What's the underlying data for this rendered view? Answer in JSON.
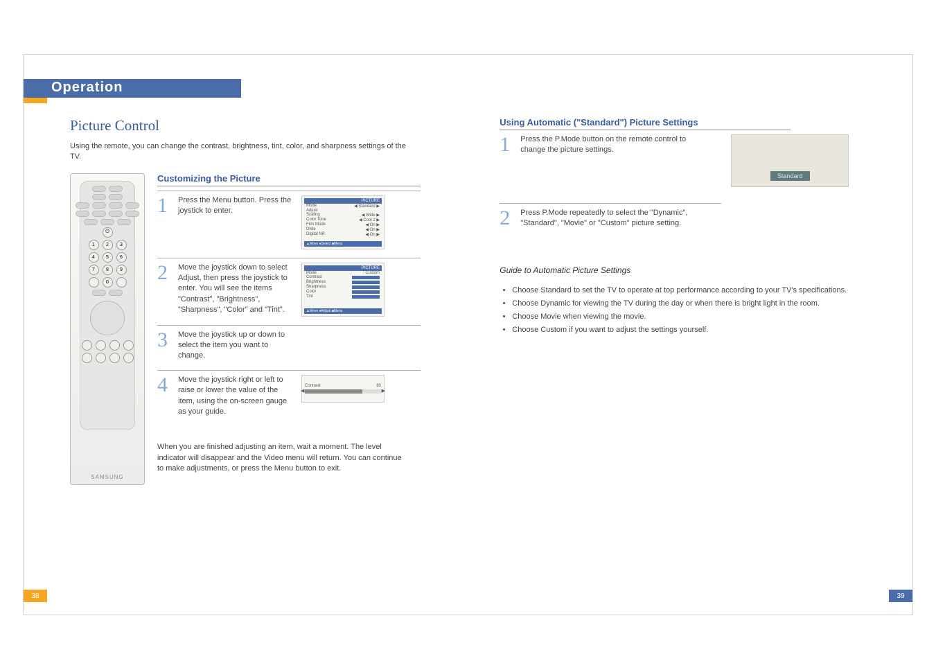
{
  "header": {
    "operation": "Operation"
  },
  "left": {
    "section_title": "Picture Control",
    "intro": "Using the remote, you can change the contrast, brightness, tint, color, and sharpness settings of the TV.",
    "customizing_heading": "Customizing the Picture",
    "remote_brand": "SAMSUNG",
    "steps": {
      "s1_num": "1",
      "s1_text": "Press the Menu button. Press the joystick to enter.",
      "s2_num": "2",
      "s2_text": "Move the joystick down to select Adjust, then press the joystick to enter. You will see the items \"Contrast\", \"Brightness\", \"Sharpness\", \"Color\" and \"Tint\".",
      "s3_num": "3",
      "s3_text": "Move the joystick up or down to select the item you want to change.",
      "s4_num": "4",
      "s4_text": "Move the joystick right or left to raise or lower the value of the item, using the on-screen gauge as your guide."
    },
    "after": "When you are finished adjusting an item, wait a moment. The level indicator will disappear and the Video menu will return. You can continue to make adjustments, or press the Menu button to exit.",
    "osd1": {
      "title": "PICTURE",
      "rows": [
        [
          "Mode",
          "◀ Standard ▶"
        ],
        [
          "Adjust",
          ""
        ],
        [
          "Scaling",
          "◀   Wide   ▶"
        ],
        [
          "Color Tone",
          "◀  Cool 2  ▶"
        ],
        [
          "Film Mode",
          "◀    On    ▶"
        ],
        [
          "DNIe",
          "◀    On    ▶"
        ],
        [
          "Digital NR",
          "◀    On    ▶"
        ]
      ],
      "foot": "▲Move  ●Select  ■Menu"
    },
    "osd2": {
      "title": "PICTURE",
      "mode_row": [
        "Mode",
        ": Custom"
      ],
      "items": [
        "Contrast",
        "Brightness",
        "Sharpness",
        "Color",
        "Tint"
      ],
      "foot": "▲Move  ●Adjust  ■Menu"
    },
    "slider": {
      "label": "Contrast",
      "value": "80"
    }
  },
  "right": {
    "heading": "Using Automatic (\"Standard\") Picture Settings",
    "standard_label": "Standard",
    "s1_num": "1",
    "s1_text": "Press the P.Mode button on the remote control to change the picture settings.",
    "s2_num": "2",
    "s2_text": "Press P.Mode repeatedly to select the \"Dynamic\", \"Standard\", \"Movie\" or \"Custom\" picture setting.",
    "guide_title": "Guide to Automatic Picture Settings",
    "bullets": [
      "Choose Standard to set the TV to operate at top performance according to your TV's specifications.",
      "Choose Dynamic for viewing the TV during the day or when there is bright light in the room.",
      "Choose Movie when viewing the movie.",
      "Choose Custom if you want to adjust the settings yourself."
    ]
  },
  "pages": {
    "left": "38",
    "right": "39"
  }
}
